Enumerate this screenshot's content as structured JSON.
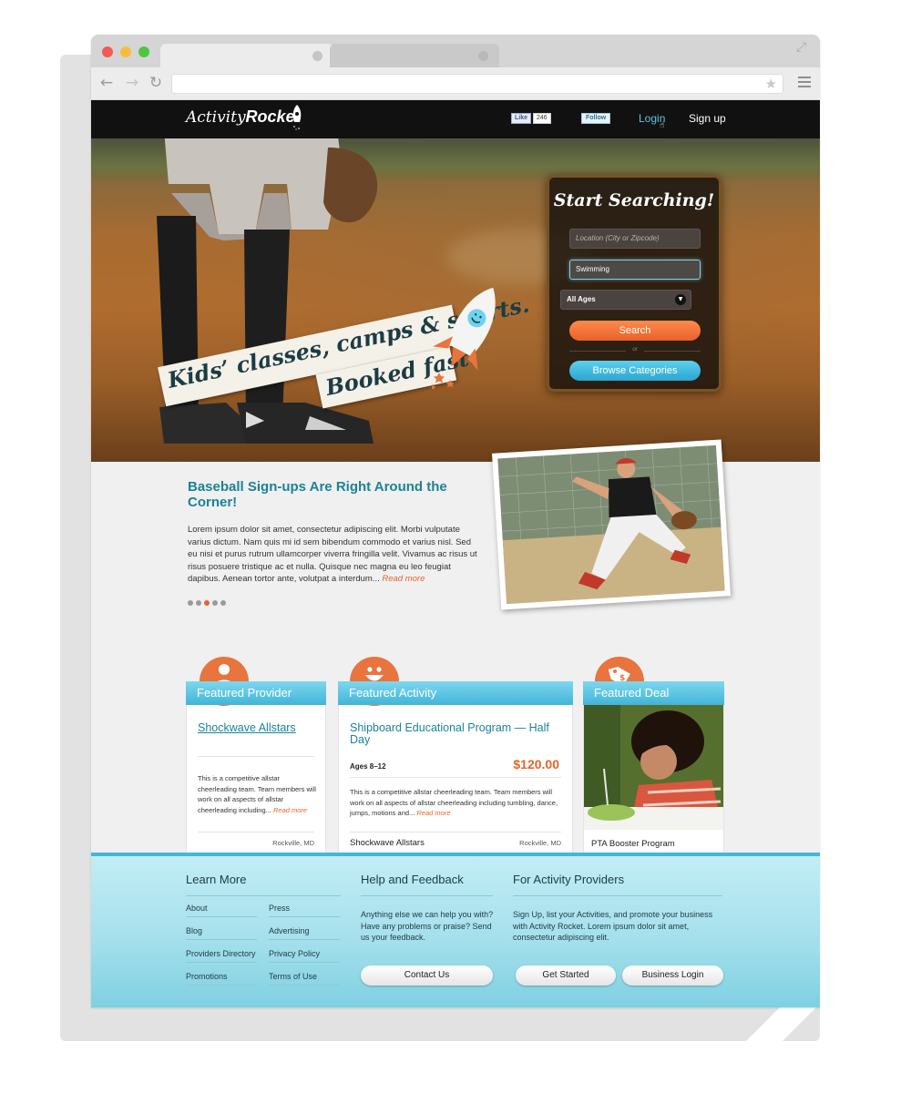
{
  "site": {
    "logo_text_a": "Activity",
    "logo_text_b": "Rocket",
    "fb_like": "Like",
    "fb_count": "246",
    "tw_follow": "Follow",
    "login": "Login",
    "signup": "Sign up"
  },
  "hero": {
    "tagline_line1": "Kids’ classes, camps & sports.",
    "tagline_line2": "Booked fast.",
    "search": {
      "title": "Start Searching!",
      "location_placeholder": "Location (City or Zipcode)",
      "activity_value": "Swimming",
      "ages_value": "All Ages",
      "search_button": "Search",
      "or": "or",
      "browse_button": "Browse Categories"
    }
  },
  "story": {
    "title": "Baseball Sign-ups Are Right Around the Corner!",
    "body": "Lorem ipsum dolor sit amet, consectetur adipiscing elit. Morbi vulputate varius dictum. Nam quis mi id sem bibendum commodo et varius nisl. Sed eu nisi et purus rutrum ullamcorper viverra fringilla velit. Vivamus ac risus ut risus posuere tristique ac et nulla. Quisque nec magna eu leo feugiat dapibus. Aenean tortor ante, volutpat a interdum...",
    "read_more": "Read more",
    "carousel_count": 5,
    "carousel_active": 3
  },
  "featured": {
    "provider": {
      "heading": "Featured Provider",
      "name": "Shockwave Allstars",
      "description": "This is a competitive allstar cheerleading team. Team members will work on all aspects of allstar cheerleading including...",
      "read_more": "Read more",
      "location": "Rockville, MD"
    },
    "activity": {
      "heading": "Featured Activity",
      "name": "Shipboard Educational Program — Half Day",
      "ages": "Ages 8–12",
      "price": "$120.00",
      "description": "This is a competitive allstar cheerleading team. Team members will work on all aspects of allstar cheerleading including tumbling, dance, jumps, motions and...",
      "read_more": "Read more",
      "provider": "Shockwave Allstars",
      "location": "Rockville, MD"
    },
    "deal": {
      "heading": "Featured Deal",
      "name": "PTA Booster Program"
    }
  },
  "footer": {
    "learn_more": {
      "heading": "Learn More",
      "col1": [
        "About",
        "Blog",
        "Providers Directory",
        "Promotions"
      ],
      "col2": [
        "Press",
        "Advertising",
        "Privacy Policy",
        "Terms of Use"
      ]
    },
    "help": {
      "heading": "Help and Feedback",
      "text": "Anything else we can help you with? Have any problems or praise? Send us your feedback.",
      "button": "Contact Us"
    },
    "providers": {
      "heading": "For Activity Providers",
      "text": "Sign Up, list your Activities, and promote your business with Activity Rocket. Lorem ipsum dolor sit amet, consectetur adipiscing elit.",
      "button1": "Get Started",
      "button2": "Business Login"
    }
  },
  "colors": {
    "accent_teal": "#1b8396",
    "accent_orange": "#e4642a",
    "header_blue": "#41b5d8"
  }
}
